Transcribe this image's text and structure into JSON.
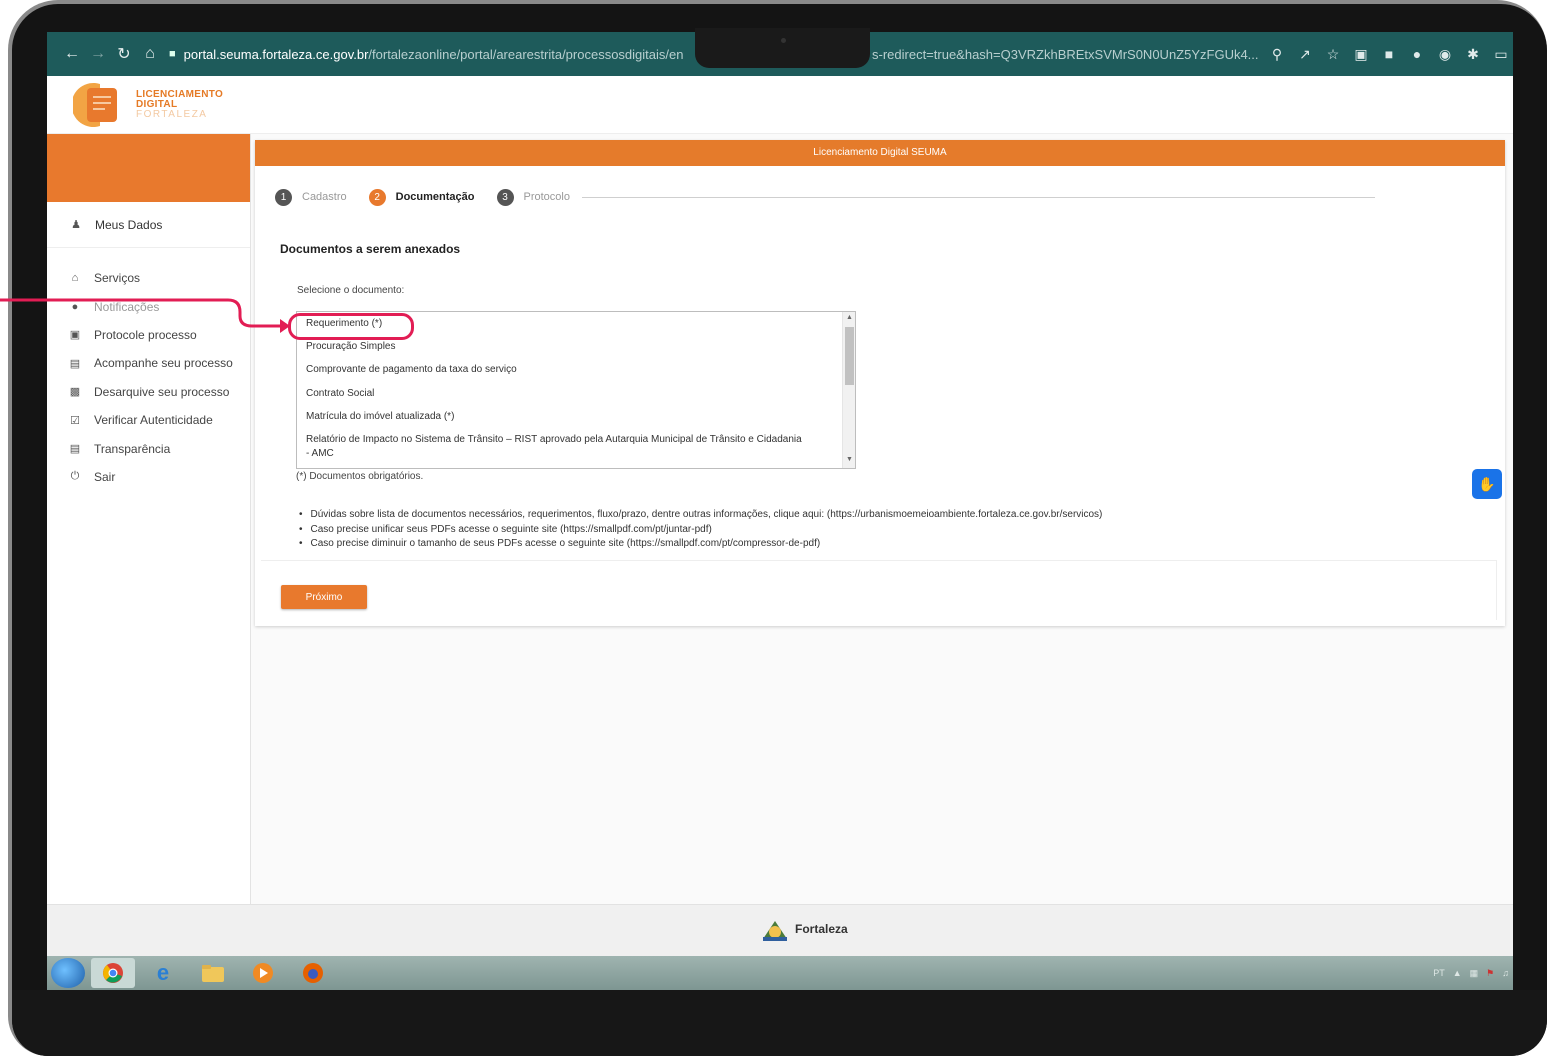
{
  "browser": {
    "url_host": "portal.seuma.fortaleza.ce.gov.br",
    "url_path": "/fortalezaonline/portal/arearestrita/processosdigitais/en",
    "url_tail": "s-redirect=true&hash=Q3VRZkhBREtxSVMrS0N0UnZ5YzFGUk4..."
  },
  "header": {
    "logo_line1": "LICENCIAMENTO",
    "logo_line2": "DIGITAL",
    "logo_line3": "FORTALEZA"
  },
  "sidebar": {
    "user_label": "Meus Dados",
    "items": [
      {
        "label": "Serviços",
        "icon": "home-icon"
      },
      {
        "label": "Notificações",
        "icon": "alert-icon"
      },
      {
        "label": "Protocole processo",
        "icon": "add-doc-icon"
      },
      {
        "label": "Acompanhe seu processo",
        "icon": "list-icon"
      },
      {
        "label": "Desarquive seu processo",
        "icon": "archive-icon"
      },
      {
        "label": "Verificar Autenticidade",
        "icon": "check-icon"
      },
      {
        "label": "Transparência",
        "icon": "document-icon"
      },
      {
        "label": "Sair",
        "icon": "power-icon"
      }
    ]
  },
  "main": {
    "panel_title": "Licenciamento Digital SEUMA",
    "steps": [
      {
        "num": "1",
        "label": "Cadastro",
        "active": false
      },
      {
        "num": "2",
        "label": "Documentação",
        "active": true
      },
      {
        "num": "3",
        "label": "Protocolo",
        "active": false
      }
    ],
    "section_title": "Documentos a serem anexados",
    "select_label": "Selecione o documento:",
    "documents": [
      "Requerimento (*)",
      "Procuração Simples",
      "Comprovante de pagamento da taxa do serviço",
      "Contrato Social",
      "Matrícula do imóvel atualizada (*)",
      "Relatório de Impacto no Sistema de Trânsito – RIST aprovado pela Autarquia Municipal de Trânsito e Cidadania - AMC"
    ],
    "required_note": "(*) Documentos obrigatórios.",
    "info": [
      "Dúvidas sobre lista de documentos necessários, requerimentos, fluxo/prazo, dentre outras informações, clique aqui: (https://urbanismoemeioambiente.fortaleza.ce.gov.br/servicos)",
      "Caso precise unificar seus PDFs acesse o seguinte site (https://smallpdf.com/pt/juntar-pdf)",
      "Caso precise diminuir o tamanho de seus PDFs acesse o seguinte site (https://smallpdf.com/pt/compressor-de-pdf)"
    ],
    "next_label": "Próximo"
  },
  "footer": {
    "brand": "Fortaleza"
  },
  "taskbar": {
    "lang": "PT"
  },
  "colors": {
    "accent": "#e8792d",
    "browser_bar": "#1e5b5b",
    "annotation": "#e21d54"
  }
}
